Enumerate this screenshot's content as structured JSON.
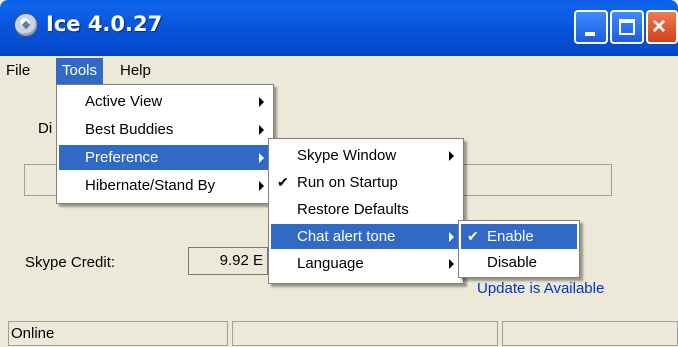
{
  "window": {
    "title": "Ice 4.0.27"
  },
  "menubar": [
    "File",
    "Tools",
    "Help"
  ],
  "tools_menu": [
    {
      "label": "Active View",
      "submenu": true
    },
    {
      "label": "Best Buddies",
      "submenu": true
    },
    {
      "label": "Preference",
      "submenu": true,
      "highlighted": true
    },
    {
      "label": "Hibernate/Stand By",
      "submenu": true
    }
  ],
  "preference_menu": [
    {
      "label": "Skype Window",
      "submenu": true
    },
    {
      "label": "Run on Startup",
      "checked": true
    },
    {
      "label": "Restore Defaults"
    },
    {
      "label": "Chat alert tone",
      "submenu": true,
      "highlighted": true
    },
    {
      "label": "Language",
      "submenu": true
    }
  ],
  "chat_alert_menu": [
    {
      "label": "Enable",
      "checked": true,
      "highlighted": true
    },
    {
      "label": "Disable"
    }
  ],
  "main": {
    "partial_label": "Di",
    "credit_label": "Skype Credit:",
    "credit_value": "9.92 E",
    "update_text": "Update is Available"
  },
  "statusbar": {
    "status": "Online"
  },
  "colors": {
    "highlight": "#316AC5",
    "title_blue": "#0753D8",
    "link": "#0033CC"
  }
}
